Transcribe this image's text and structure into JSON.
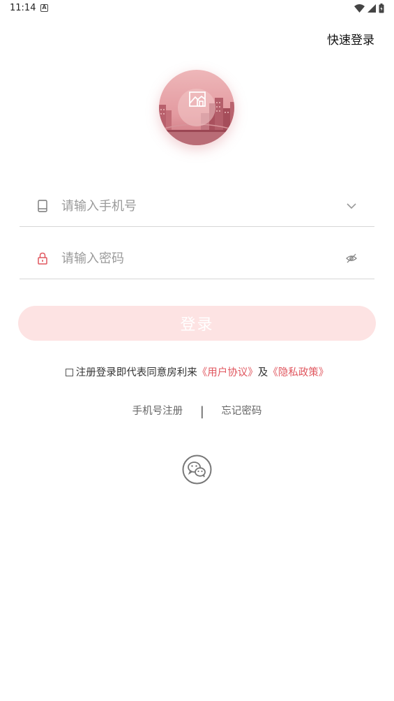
{
  "status_bar": {
    "time": "11:14",
    "notification_icon": "a-letter-icon",
    "wifi_icon": "wifi-icon",
    "signal_icon": "cell-signal-icon",
    "battery_icon": "battery-icon"
  },
  "header": {
    "quick_login_label": "快速登录"
  },
  "logo": {
    "icon": "house-image-icon",
    "colors": {
      "sky": "#e9a3a8",
      "city": "#b85f6a",
      "glow": "#f3c8c9"
    }
  },
  "form": {
    "phone": {
      "placeholder": "请输入手机号",
      "value": "",
      "icon": "phone-icon",
      "trailing_icon": "chevron-down-icon"
    },
    "password": {
      "placeholder": "请输入密码",
      "value": "",
      "icon": "lock-icon",
      "trailing_icon": "eye-hidden-icon"
    },
    "login_label": "登录"
  },
  "agreement": {
    "checked": false,
    "prefix": "注册登录即代表同意房利来",
    "user_agreement": "《用户协议》",
    "and": "及",
    "privacy_policy": "《隐私政策》"
  },
  "links": {
    "register": "手机号注册",
    "divider": "|",
    "forgot": "忘记密码"
  },
  "social": {
    "wechat_icon": "wechat-icon"
  },
  "colors": {
    "accent": "#e0575f",
    "button_bg": "#fde3e3",
    "divider": "#d6d6d6"
  }
}
